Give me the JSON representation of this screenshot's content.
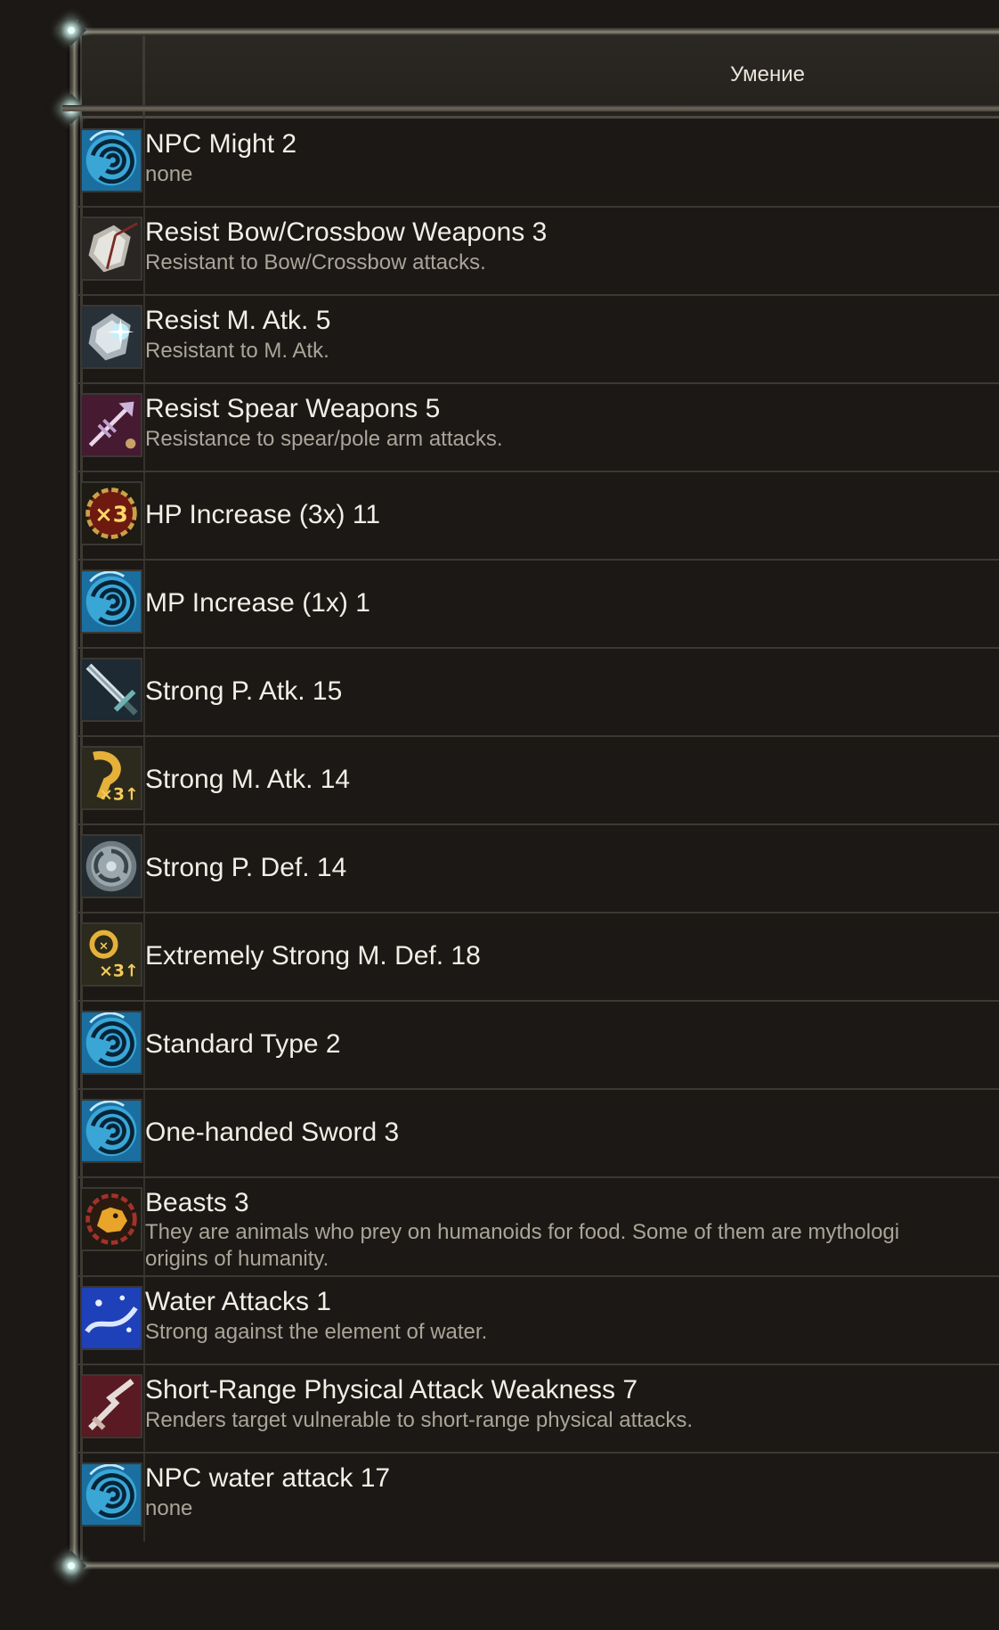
{
  "header": {
    "title": "Умение"
  },
  "skills": [
    {
      "name": "NPC Might 2",
      "desc": "none",
      "icon": "blue-vortex-icon"
    },
    {
      "name": "Resist Bow/Crossbow Weapons 3",
      "desc": "Resistant to Bow/Crossbow attacks.",
      "icon": "shield-arrow-icon"
    },
    {
      "name": "Resist M. Atk. 5",
      "desc": "Resistant to M. Atk.",
      "icon": "shield-magic-icon"
    },
    {
      "name": "Resist Spear Weapons 5",
      "desc": "Resistance to spear/pole arm attacks.",
      "icon": "spear-icon"
    },
    {
      "name": "HP Increase (3x) 11",
      "desc": "",
      "icon": "x3-gold-emblem-icon"
    },
    {
      "name": "MP Increase (1x) 1",
      "desc": "",
      "icon": "blue-vortex-icon"
    },
    {
      "name": "Strong P. Atk. 15",
      "desc": "",
      "icon": "sword-icon"
    },
    {
      "name": "Strong M. Atk. 14",
      "desc": "",
      "icon": "gold-x3-up-icon"
    },
    {
      "name": "Strong P. Def. 14",
      "desc": "",
      "icon": "round-shield-icon"
    },
    {
      "name": "Extremely Strong M. Def. 18",
      "desc": "",
      "icon": "gold-x3-up-icon"
    },
    {
      "name": "Standard Type 2",
      "desc": "",
      "icon": "blue-vortex-icon"
    },
    {
      "name": "One-handed Sword 3",
      "desc": "",
      "icon": "blue-vortex-icon"
    },
    {
      "name": "Beasts 3",
      "desc_line1": "They are animals who prey on humanoids for food. Some of them are mythologi",
      "desc_line2": "origins of humanity.",
      "icon": "beast-emblem-icon"
    },
    {
      "name": "Water Attacks 1",
      "desc": "Strong against the element of water.",
      "icon": "water-icon"
    },
    {
      "name": "Short-Range Physical Attack Weakness 7",
      "desc": "Renders target vulnerable to short-range physical attacks.",
      "icon": "broken-blade-icon"
    },
    {
      "name": "NPC water attack 17",
      "desc": "none",
      "icon": "blue-vortex-icon"
    }
  ]
}
